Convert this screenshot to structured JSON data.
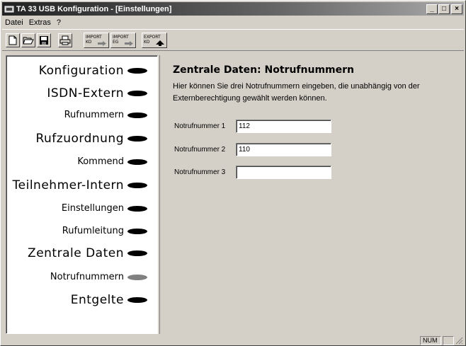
{
  "window": {
    "title": "TA 33 USB Konfiguration - [Einstellungen]",
    "minimize": "_",
    "maximize": "□",
    "close": "×"
  },
  "menu": [
    "Datei",
    "Extras",
    "?"
  ],
  "toolbar": {
    "buttons": [
      "new-icon",
      "open-icon",
      "save-icon",
      "print-icon"
    ],
    "import_ko": {
      "line1": "IMPORT",
      "line2": "KO"
    },
    "import_eg": {
      "line1": "IMPORT",
      "line2": "EG"
    },
    "export_ko": {
      "line1": "EXPORT",
      "line2": "KO"
    }
  },
  "nav": {
    "items": [
      {
        "label": "Konfiguration",
        "size": "big",
        "active": false
      },
      {
        "label": "ISDN-Extern",
        "size": "big",
        "active": false
      },
      {
        "label": "Rufnummern",
        "size": "small",
        "active": false
      },
      {
        "label": "Rufzuordnung",
        "size": "big",
        "active": false
      },
      {
        "label": "Kommend",
        "size": "small",
        "active": false
      },
      {
        "label": "Teilnehmer-Intern",
        "size": "big",
        "active": false
      },
      {
        "label": "Einstellungen",
        "size": "small",
        "active": false
      },
      {
        "label": "Rufumleitung",
        "size": "small",
        "active": false
      },
      {
        "label": "Zentrale Daten",
        "size": "big",
        "active": false
      },
      {
        "label": "Notrufnummern",
        "size": "small",
        "active": true
      },
      {
        "label": "Entgelte",
        "size": "big",
        "active": false
      }
    ]
  },
  "content": {
    "title": "Zentrale Daten: Notrufnummern",
    "description": "Hier können Sie drei Notrufnummern eingeben, die unabhängig von der Externberechtigung gewählt werden können.",
    "fields": [
      {
        "label": "Notrufnummer 1",
        "value": "112"
      },
      {
        "label": "Notrufnummer 2",
        "value": "110"
      },
      {
        "label": "Notrufnummer 3",
        "value": ""
      }
    ]
  },
  "status": {
    "num": "NUM"
  },
  "colors": {
    "active_dot": "#808080",
    "dot": "#000000",
    "face": "#d4d0c8"
  }
}
